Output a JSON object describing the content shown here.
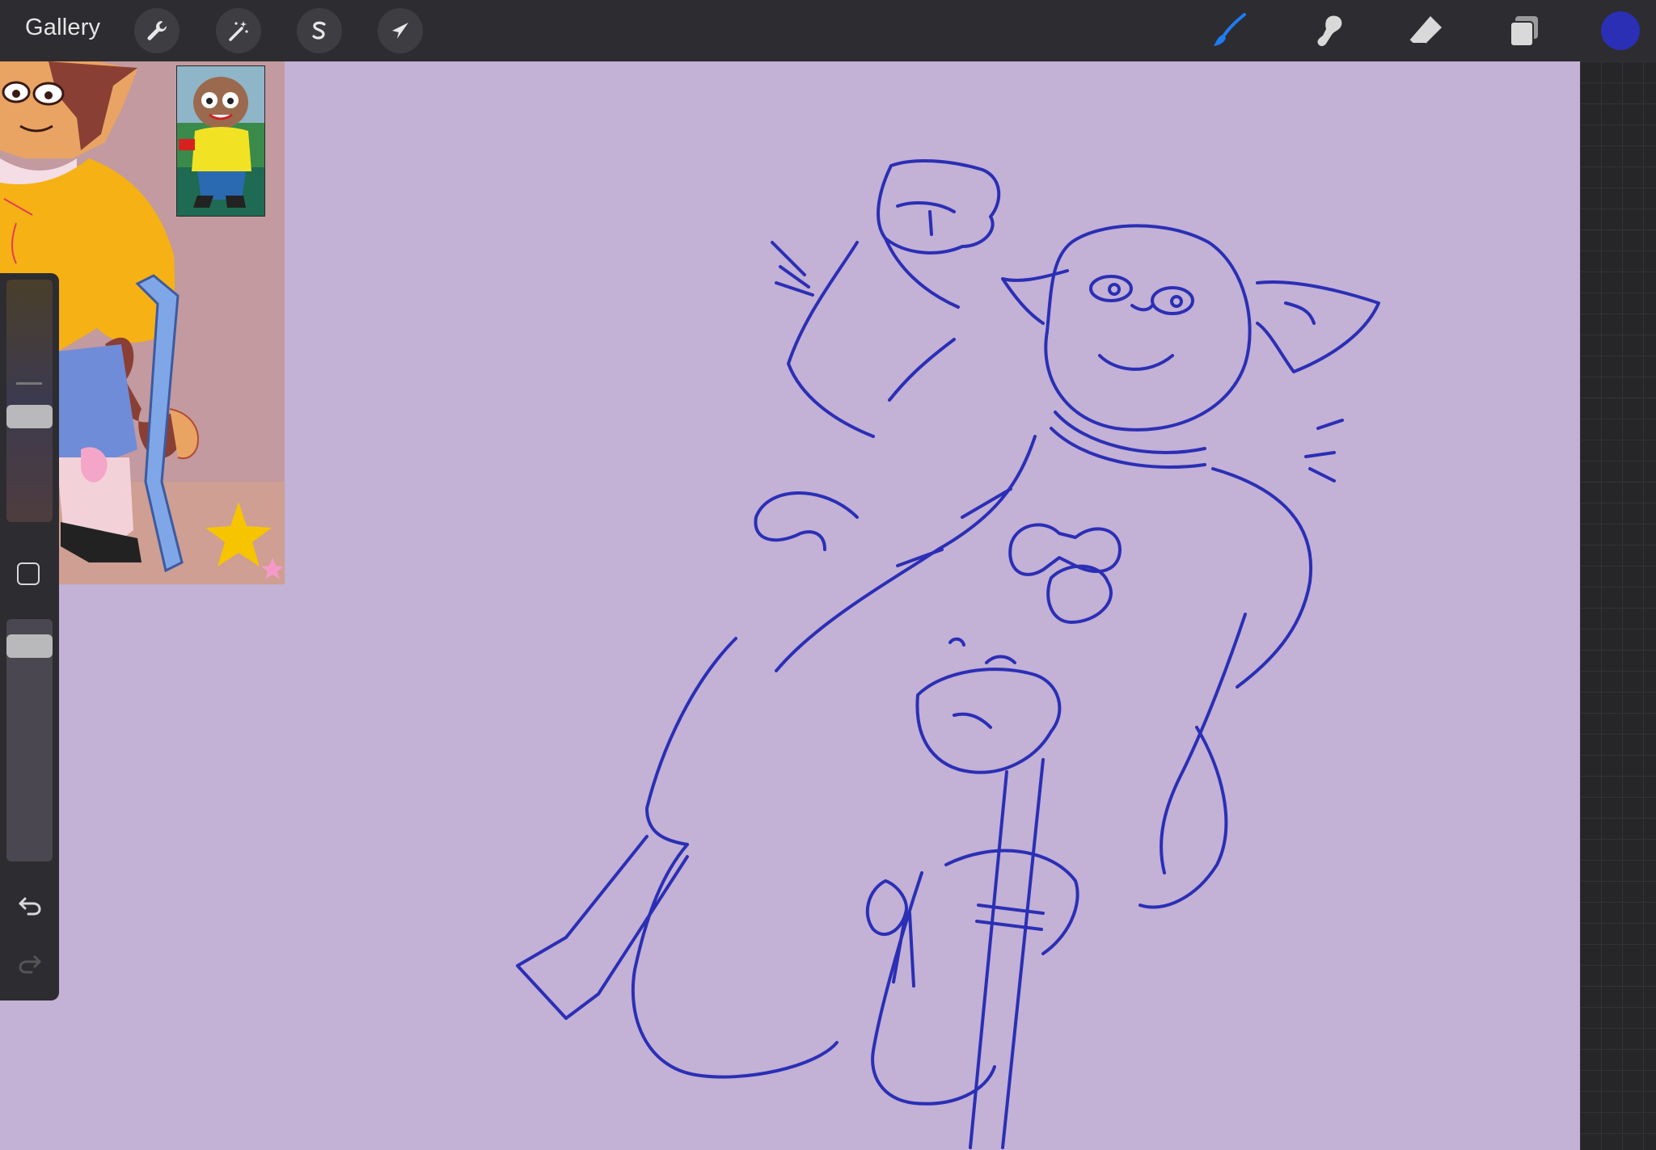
{
  "toolbar": {
    "gallery_label": "Gallery",
    "left_tools": [
      "wrench-icon",
      "magic-wand-icon",
      "selection-s-icon",
      "transform-arrow-icon"
    ],
    "right_tools": [
      "brush-icon",
      "smudge-icon",
      "eraser-icon",
      "layers-icon"
    ],
    "active_tool": "brush",
    "active_tool_color": "#1e7cf2",
    "current_color": "#2b2fb5"
  },
  "sidebar": {
    "brush_size_label": "brush-size-slider",
    "opacity_label": "opacity-slider",
    "modify_button": "modify-button",
    "undo": "undo-icon",
    "redo": "redo-icon"
  },
  "canvas": {
    "background_color": "#c3b1d6",
    "line_color": "#2b2fb5",
    "content": "sketch-of-cat-character-with-crutch"
  },
  "references": [
    "reference-image-colored-character",
    "reference-image-small-character"
  ]
}
